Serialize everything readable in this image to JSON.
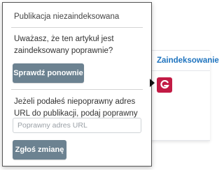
{
  "background_panel": {
    "link_label": "Zaindeksowanie",
    "service_icon": {
      "name": "g-logo-icon",
      "letter": "G",
      "color": "#c21b45"
    }
  },
  "popover": {
    "title": "Publikacja niezaindeksowana",
    "question": "Uważasz, że ten artykuł jest zaindeksowany poprawnie?",
    "recheck_button_label": "Sprawdź ponownie",
    "instructions": "Jeżeli podałeś niepoprawny adres URL do publikacji, podaj poprawny poniżej.",
    "url_input": {
      "placeholder": "Poprawny adres URL",
      "value": ""
    },
    "submit_button_label": "Zgłoś zmianę"
  },
  "colors": {
    "button": "#6c8291",
    "link": "#1e73be",
    "brand_icon": "#c21b45",
    "popover_border": "#555555"
  }
}
